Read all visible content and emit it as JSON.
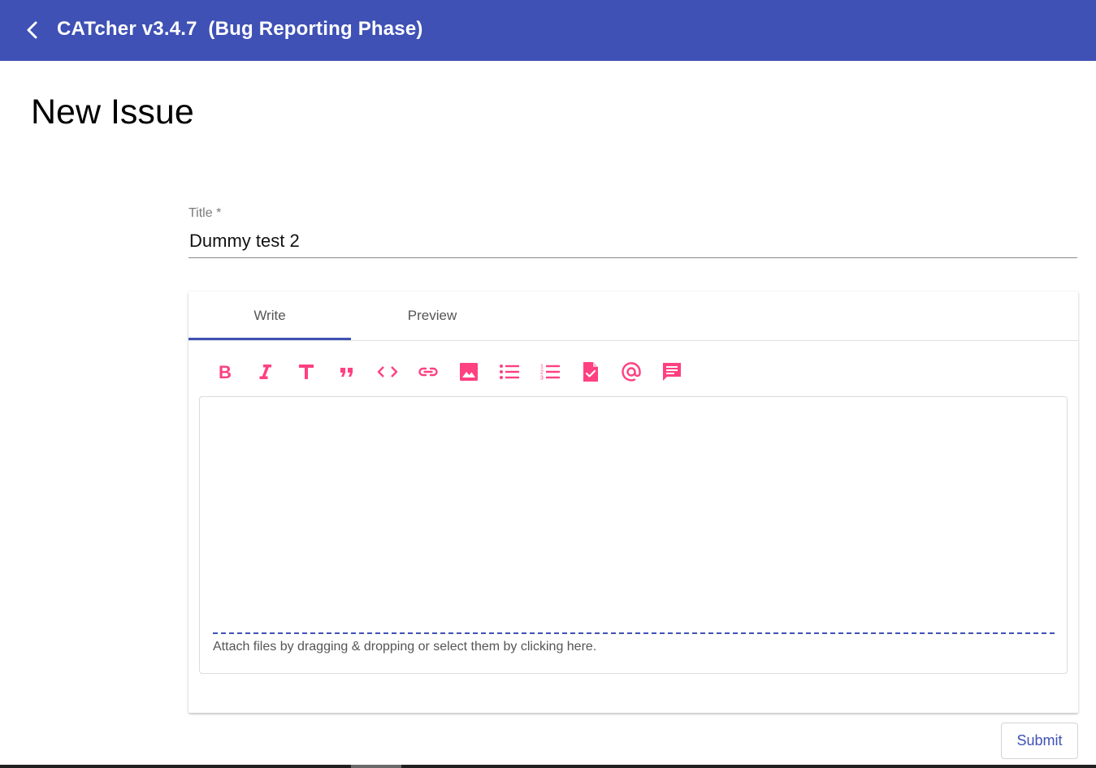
{
  "header": {
    "app_title": "CATcher v3.4.7  (Bug Reporting Phase)",
    "back_icon": "chevron-left-icon",
    "bg_color": "#3f51b5"
  },
  "page": {
    "title": "New Issue"
  },
  "form": {
    "title_label": "Title *",
    "title_value": "Dummy test 2",
    "tabs": [
      {
        "label": "Write",
        "active": true
      },
      {
        "label": "Preview",
        "active": false
      }
    ],
    "toolbar": [
      {
        "name": "bold-icon"
      },
      {
        "name": "italic-icon"
      },
      {
        "name": "header-icon"
      },
      {
        "name": "quote-icon"
      },
      {
        "name": "code-icon"
      },
      {
        "name": "link-icon"
      },
      {
        "name": "image-icon"
      },
      {
        "name": "unordered-list-icon"
      },
      {
        "name": "ordered-list-icon"
      },
      {
        "name": "task-list-icon"
      },
      {
        "name": "mention-icon"
      },
      {
        "name": "saved-reply-icon"
      }
    ],
    "toolbar_color": "#ff4081",
    "body_value": "",
    "attach_text": "Attach files by dragging & dropping or select them by clicking here.",
    "submit_label": "Submit"
  }
}
